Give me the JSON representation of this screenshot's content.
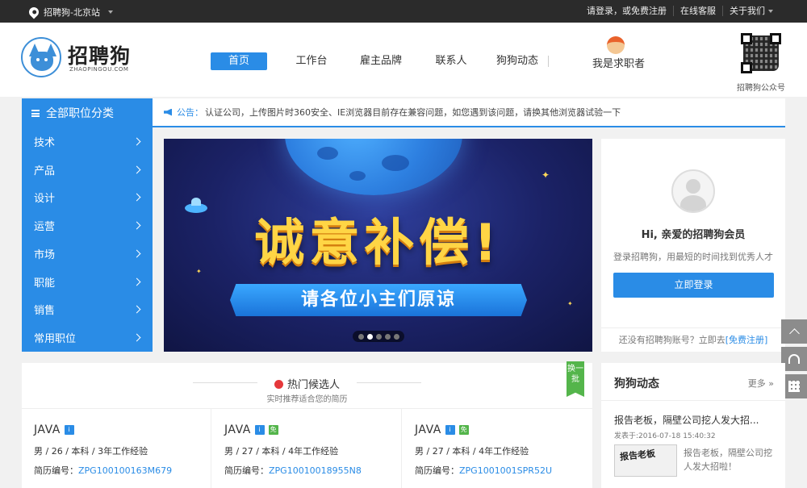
{
  "topbar": {
    "location": "招聘狗-北京站",
    "login_link": "请登录，或免费注册",
    "online_service": "在线客服",
    "about": "关于我们"
  },
  "header": {
    "logo_text": "招聘狗",
    "logo_sub": "ZHAOPINGOU.COM",
    "qr_label": "招聘狗公众号",
    "nav": [
      "首页",
      "工作台",
      "雇主品牌",
      "联系人",
      "狗狗动态"
    ],
    "seeker": "我是求职者"
  },
  "categories": {
    "title": "全部职位分类",
    "items": [
      "技术",
      "产品",
      "设计",
      "运营",
      "市场",
      "职能",
      "销售",
      "常用职位"
    ]
  },
  "notice": {
    "label": "公告：",
    "text": "认证公司，上传图片时360安全、IE浏览器目前存在兼容问题，如您遇到该问题，请换其他浏览器试验一下"
  },
  "banner": {
    "headline": "诚意补偿!",
    "ribbon": "请各位小主们原谅",
    "slides": 5,
    "active_slide": 2
  },
  "login": {
    "greeting": "Hi, 亲爱的招聘狗会员",
    "subtitle": "登录招聘狗，用最短的时间找到优秀人才",
    "button": "立即登录",
    "footer_text": "还没有招聘狗账号？立即去",
    "register_link": "[免费注册]"
  },
  "hot": {
    "title": "热门候选人",
    "subtitle": "实时推荐适合您的简历",
    "swap": "换一批",
    "rid_label": "简历编号：",
    "cards": [
      {
        "position": "JAVA",
        "info": "i",
        "free": "",
        "meta": "男 / 26 / 本科 / 3年工作经验",
        "rid": "ZPG100100163M679"
      },
      {
        "position": "JAVA",
        "info": "i",
        "free": "免",
        "meta": "男 / 27 / 本科 / 4年工作经验",
        "rid": "ZPG10010018955N8"
      },
      {
        "position": "JAVA",
        "info": "i",
        "free": "免",
        "meta": "男 / 27 / 本科 / 4年工作经验",
        "rid": "ZPG1001001SPR52U"
      }
    ]
  },
  "news": {
    "title": "狗狗动态",
    "more": "更多",
    "article_title": "报告老板，隔壁公司挖人发大招...",
    "date": "发表于:2016-07-18 15:40:32",
    "thumb_text": "报告老板",
    "snippet": "报告老板，隔壁公司挖人发大招啦！"
  },
  "colors": {
    "primary": "#2a8ce6",
    "topbar": "#2b2b2b",
    "headline": "#ffd545",
    "green": "#54b54b"
  }
}
